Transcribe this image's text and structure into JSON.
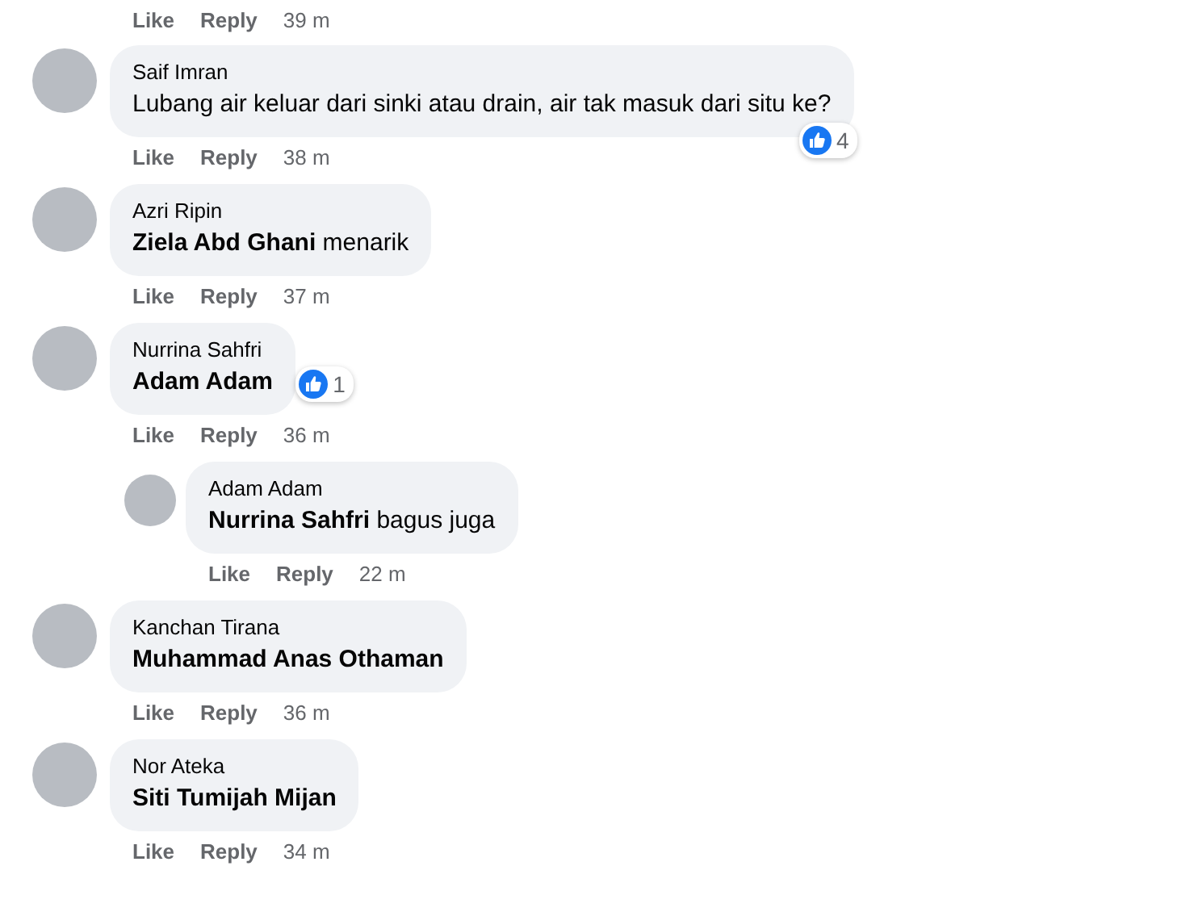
{
  "previous_actions": {
    "like": "Like",
    "reply": "Reply",
    "time": "39 m"
  },
  "comments": [
    {
      "author": "Saif Imran",
      "text": "Lubang air keluar dari sinki atau drain, air tak masuk dari situ ke?",
      "reaction": {
        "count": "4"
      },
      "actions": {
        "like": "Like",
        "reply": "Reply",
        "time": "38 m"
      }
    },
    {
      "author": "Azri Ripin",
      "mention": "Ziela Abd Ghani",
      "text": "menarik",
      "actions": {
        "like": "Like",
        "reply": "Reply",
        "time": "37 m"
      }
    },
    {
      "author": "Nurrina Sahfri",
      "mention": "Adam Adam",
      "reaction": {
        "count": "1"
      },
      "actions": {
        "like": "Like",
        "reply": "Reply",
        "time": "36 m"
      },
      "replies": [
        {
          "author": "Adam Adam",
          "mention": "Nurrina Sahfri",
          "text": "bagus juga",
          "actions": {
            "like": "Like",
            "reply": "Reply",
            "time": "22 m"
          }
        }
      ]
    },
    {
      "author": "Kanchan Tirana",
      "mention": "Muhammad Anas Othaman",
      "actions": {
        "like": "Like",
        "reply": "Reply",
        "time": "36 m"
      }
    },
    {
      "author": "Nor Ateka",
      "mention": "Siti Tumijah Mijan",
      "actions": {
        "like": "Like",
        "reply": "Reply",
        "time": "34 m"
      }
    }
  ]
}
